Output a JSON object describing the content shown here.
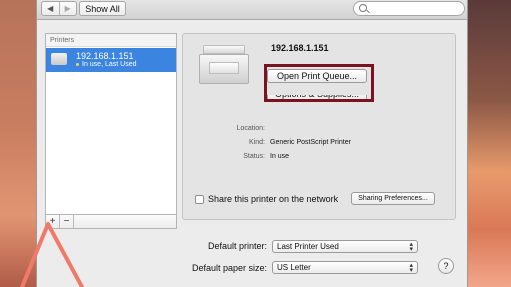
{
  "toolbar": {
    "back": "◀",
    "forward": "▶",
    "show_all": "Show All",
    "search_placeholder": ""
  },
  "printers_list": {
    "header": "Printers",
    "items": [
      {
        "name": "192.168.1.151",
        "status": "In use, Last Used"
      }
    ],
    "add": "+",
    "remove": "−"
  },
  "details": {
    "printer_name": "192.168.1.151",
    "open_print_queue": "Open Print Queue...",
    "options_supplies": "Options & Supplies...",
    "info": [
      {
        "label": "Location:",
        "value": ""
      },
      {
        "label": "Kind:",
        "value": "Generic PostScript Printer"
      },
      {
        "label": "Status:",
        "value": "In use"
      }
    ],
    "share_label": "Share this printer on the network",
    "share_checked": false,
    "sharing_prefs": "Sharing Preferences..."
  },
  "defaults": {
    "default_printer_label": "Default printer:",
    "default_printer_value": "Last Printer Used",
    "paper_size_label": "Default paper size:",
    "paper_size_value": "US Letter",
    "help": "?"
  },
  "colors": {
    "selection": "#3b84e0",
    "highlight_box": "#7a1220",
    "annotation_arrow": "#f07a6a"
  }
}
